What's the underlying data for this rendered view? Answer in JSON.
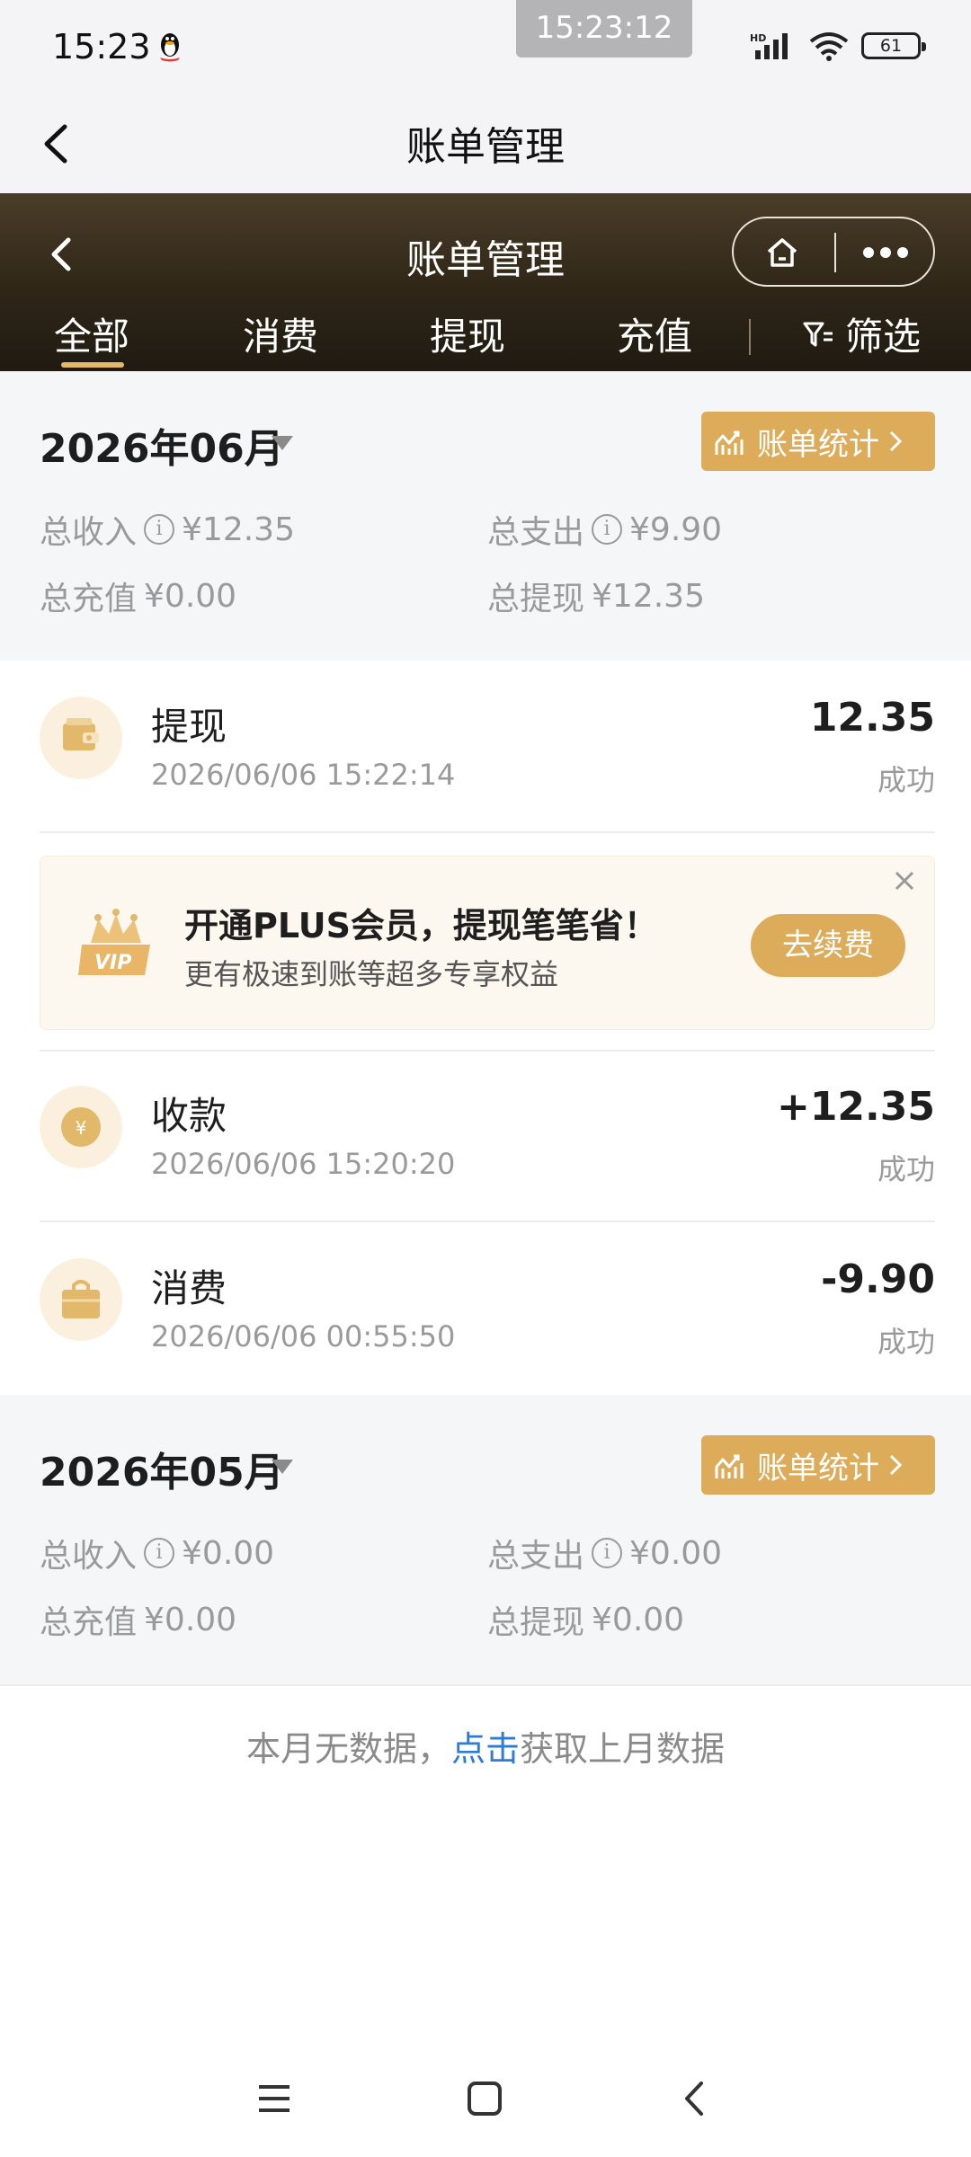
{
  "status_bar": {
    "time": "15:23",
    "timer": "15:23:12",
    "battery": "61"
  },
  "outer_title": "账单管理",
  "header": {
    "title": "账单管理",
    "tabs": [
      "全部",
      "消费",
      "提现",
      "充值"
    ],
    "active_tab": "全部",
    "filter_label": "筛选"
  },
  "months": [
    {
      "label": "2026年06月",
      "stats_button": "账单统计",
      "total_income_label": "总收入",
      "total_income": "¥12.35",
      "total_expense_label": "总支出",
      "total_expense": "¥9.90",
      "total_recharge_label": "总充值",
      "total_recharge": "¥0.00",
      "total_withdraw_label": "总提现",
      "total_withdraw": "¥12.35"
    },
    {
      "label": "2026年05月",
      "stats_button": "账单统计",
      "total_income_label": "总收入",
      "total_income": "¥0.00",
      "total_expense_label": "总支出",
      "total_expense": "¥0.00",
      "total_recharge_label": "总充值",
      "total_recharge": "¥0.00",
      "total_withdraw_label": "总提现",
      "total_withdraw": "¥0.00"
    }
  ],
  "transactions": [
    {
      "title": "提现",
      "time": "2026/06/06 15:22:14",
      "amount": "12.35",
      "status": "成功",
      "icon": "wallet-icon"
    },
    {
      "title": "收款",
      "time": "2026/06/06 15:20:20",
      "amount": "+12.35",
      "status": "成功",
      "icon": "yuan-coin-icon"
    },
    {
      "title": "消费",
      "time": "2026/06/06 00:55:50",
      "amount": "-9.90",
      "status": "成功",
      "icon": "shopping-bag-icon"
    }
  ],
  "promo": {
    "title": "开通PLUS会员，提现笔笔省！",
    "subtitle": "更有极速到账等超多专享权益",
    "button": "去续费",
    "badge": "VIP"
  },
  "empty_note": {
    "prefix": "本月无数据，",
    "link": "点击",
    "suffix": "获取上月数据"
  },
  "colors": {
    "accent": "#dcac5a",
    "header_dark": "#2f2617",
    "link": "#2e7cd6"
  }
}
